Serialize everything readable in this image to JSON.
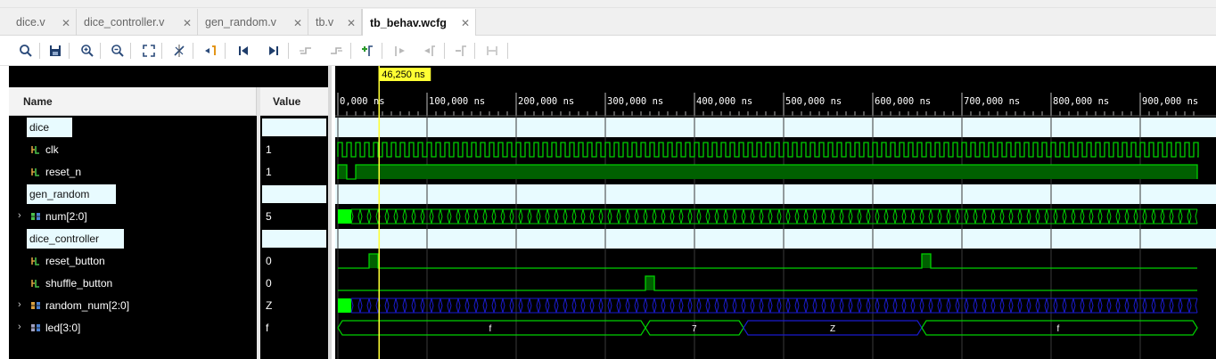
{
  "tabs": [
    {
      "label": "dice.v",
      "active": false
    },
    {
      "label": "dice_controller.v",
      "active": false
    },
    {
      "label": "gen_random.v",
      "active": false
    },
    {
      "label": "tb.v",
      "active": false
    },
    {
      "label": "tb_behav.wcfg",
      "active": true
    }
  ],
  "toolbar": {
    "buttons": [
      "search-icon",
      "save-icon",
      "zoom-in-icon",
      "zoom-out-icon",
      "zoom-fit-icon",
      "cursor-icon",
      "go-to-cursor-icon",
      "go-to-start-icon",
      "go-to-end-icon",
      "previous-transition-icon",
      "next-transition-icon",
      "add-marker-icon",
      "previous-marker-icon",
      "next-marker-icon",
      "delete-marker-icon",
      "swap-cursors-icon"
    ]
  },
  "columns": {
    "name": "Name",
    "value": "Value"
  },
  "signals": [
    {
      "name": "dice",
      "kind": "group",
      "value": ""
    },
    {
      "name": "clk",
      "kind": "bit",
      "value": "1"
    },
    {
      "name": "reset_n",
      "kind": "bit",
      "value": "1"
    },
    {
      "name": "gen_random",
      "kind": "group",
      "value": ""
    },
    {
      "name": "num[2:0]",
      "kind": "bus",
      "value": "5"
    },
    {
      "name": "dice_controller",
      "kind": "group",
      "value": ""
    },
    {
      "name": "reset_button",
      "kind": "bit",
      "value": "0"
    },
    {
      "name": "shuffle_button",
      "kind": "bit",
      "value": "0"
    },
    {
      "name": "random_num[2:0]",
      "kind": "bus",
      "value": "Z"
    },
    {
      "name": "led[3:0]",
      "kind": "bus",
      "value": "f"
    }
  ],
  "timeline": {
    "cursor_label": "46,250 ns",
    "cursor_time_ns": 46.25,
    "tick_labels": [
      "0,000 ns",
      "100,000 ns",
      "200,000 ns",
      "300,000 ns",
      "400,000 ns",
      "500,000 ns",
      "600,000 ns",
      "700,000 ns",
      "800,000 ns",
      "900,000 ns"
    ]
  },
  "led_segments": [
    "f",
    "7",
    "Z",
    "f"
  ],
  "colors": {
    "wave": "#00d000",
    "wave_fill": "#006000",
    "bus_z": "#1a1acc",
    "cursor": "#ffff33",
    "group_bg": "#e8fbff"
  }
}
